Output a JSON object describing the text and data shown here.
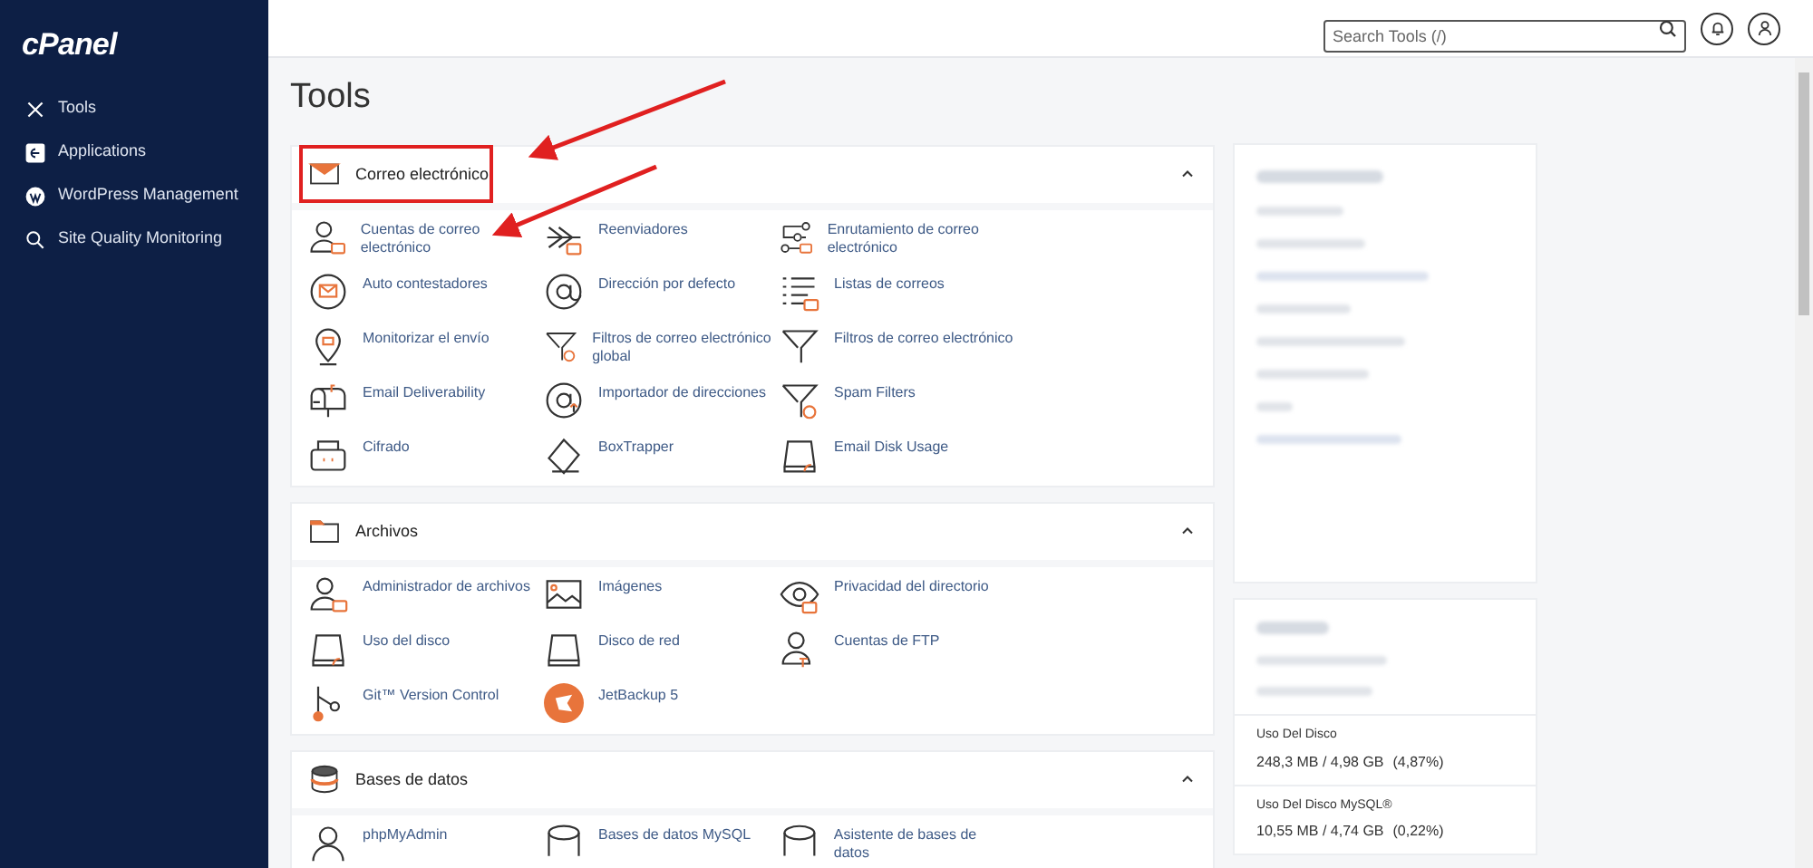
{
  "sidebar": {
    "logo": "cPanel",
    "items": [
      {
        "label": "Tools"
      },
      {
        "label": "Applications"
      },
      {
        "label": "WordPress Management"
      },
      {
        "label": "Site Quality Monitoring"
      }
    ]
  },
  "header": {
    "search": {
      "placeholder": "Search Tools (/)"
    }
  },
  "page_title": "Tools",
  "sections": [
    {
      "title": "Correo electrónico",
      "expanded": true,
      "highlighted": true,
      "items": [
        "Cuentas de correo electrónico",
        "Reenviadores",
        "Enrutamiento de correo electrónico",
        "Auto contestadores",
        "Dirección por defecto",
        "Listas de correos",
        "Monitorizar el envío",
        "Filtros de correo electrónico global",
        "Filtros de correo electrónico",
        "Email Deliverability",
        "Importador de direcciones",
        "Spam Filters",
        "Cifrado",
        "BoxTrapper",
        "Email Disk Usage"
      ]
    },
    {
      "title": "Archivos",
      "expanded": true,
      "highlighted": false,
      "items": [
        "Administrador de archivos",
        "Imágenes",
        "Privacidad del directorio",
        "Uso del disco",
        "Disco de red",
        "Cuentas de FTP",
        "Git™ Version Control",
        "JetBackup 5"
      ]
    },
    {
      "title": "Bases de datos",
      "expanded": true,
      "highlighted": false,
      "items": [
        "phpMyAdmin",
        "Bases de datos MySQL",
        "Asistente de bases de datos"
      ]
    }
  ],
  "stats": [
    {
      "label": "Uso Del Disco",
      "value": "248,3 MB / 4,98 GB",
      "percent": "(4,87%)"
    },
    {
      "label": "Uso Del Disco MySQL®",
      "value": "10,55 MB / 4,74 GB",
      "percent": "(0,22%)"
    }
  ]
}
